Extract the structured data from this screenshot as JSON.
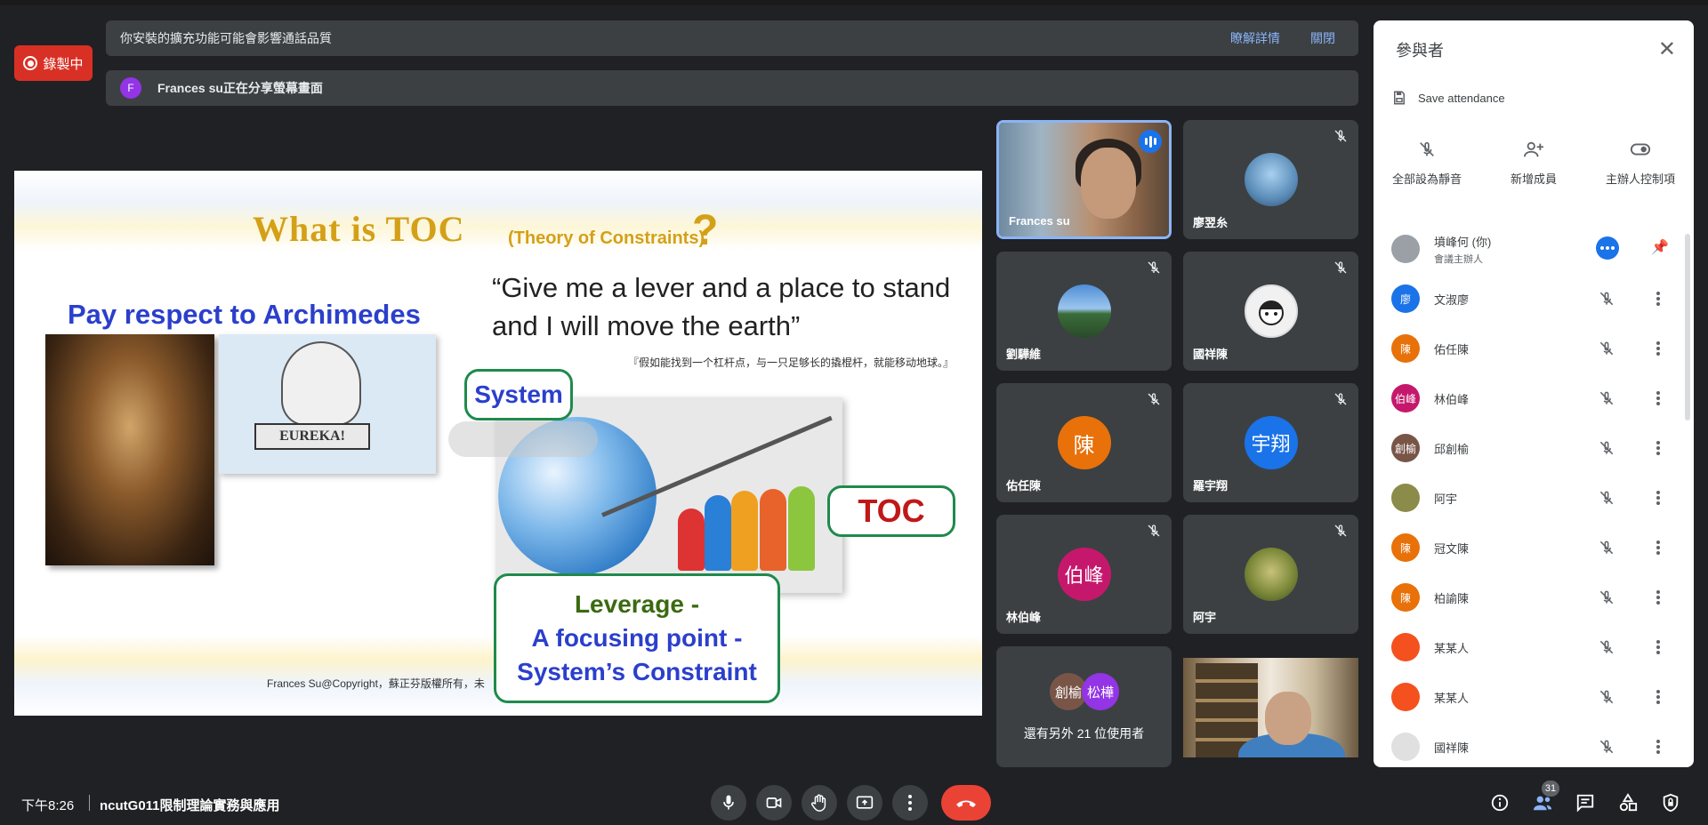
{
  "recording": {
    "label": "錄製中"
  },
  "banners": {
    "extension_warning": "你安裝的擴充功能可能會影響通話品質",
    "learn_more": "瞭解詳情",
    "close": "關閉",
    "sharing_avatar": "F",
    "sharing_text": "Frances su正在分享螢幕畫面"
  },
  "slide": {
    "title": "What is TOC",
    "subtitle": "(Theory of Constraints)",
    "question_mark": "?",
    "respect": "Pay respect to  Archimedes",
    "quote": "“Give me a lever and a place to stand and I will move the earth”",
    "chinese_quote": "『假如能找到一个杠杆点，与一只足够长的撬棍杆，就能移动地球。』",
    "eureka": "EUREKA!",
    "system_bubble": "System",
    "toc_bubble": "TOC",
    "leverage_line1": "Leverage -",
    "leverage_line2": "A focusing point -",
    "leverage_line3": "System’s Constraint",
    "copyright": "Frances Su@Copyright，蘇正芬版權所有，未"
  },
  "tiles": [
    {
      "name": "Frances su",
      "speaking": true
    },
    {
      "name": "廖翌糸",
      "muted": true
    },
    {
      "name": "劉驊維",
      "muted": true
    },
    {
      "name": "國祥陳",
      "muted": true
    },
    {
      "name": "佑任陳",
      "avatar": "陳",
      "color": "#e8710a",
      "muted": true
    },
    {
      "name": "羅宇翔",
      "avatar": "宇翔",
      "color": "#1a73e8",
      "muted": true
    },
    {
      "name": "林伯峰",
      "avatar": "伯峰",
      "color": "#c5186c",
      "muted": true
    },
    {
      "name": "阿宇",
      "muted": true
    }
  ],
  "more_tile": {
    "avatar1": "創榆",
    "avatar2": "松樺",
    "text": "還有另外 21 位使用者"
  },
  "panel": {
    "title": "參與者",
    "save_attendance": "Save attendance",
    "actions": [
      "全部設為靜音",
      "新增成員",
      "主辦人控制項"
    ],
    "participants": [
      {
        "name": "墳峰何 (你)",
        "role": "會議主辦人",
        "avatar": "",
        "color": "#9aa0a6"
      },
      {
        "name": "文淑廖",
        "avatar": "廖",
        "color": "#1a73e8"
      },
      {
        "name": "佑任陳",
        "avatar": "陳",
        "color": "#e8710a"
      },
      {
        "name": "林伯峰",
        "avatar": "伯峰",
        "color": "#c5186c"
      },
      {
        "name": "邱創榆",
        "avatar": "創榆",
        "color": "#795548"
      },
      {
        "name": "阿宇",
        "avatar": "",
        "color": "#8b8b4a"
      },
      {
        "name": "冠文陳",
        "avatar": "陳",
        "color": "#e8710a"
      },
      {
        "name": "柏諭陳",
        "avatar": "陳",
        "color": "#e8710a"
      },
      {
        "name": "某某人",
        "avatar": "",
        "color": "#f4511e"
      },
      {
        "name": "某某人",
        "avatar": "",
        "color": "#f4511e"
      },
      {
        "name": "國祥陳",
        "avatar": "",
        "color": "#e0e0e0"
      }
    ]
  },
  "bottom": {
    "time": "下午8:26",
    "meeting": "ncutG011限制理論實務與應用",
    "participant_count": "31"
  },
  "colors": {
    "accent": "#1a73e8",
    "end_call": "#ea4335",
    "recording": "#d93025"
  },
  "icons": [
    "mic-icon",
    "camera-icon",
    "raise-hand-icon",
    "present-icon",
    "more-vert-icon",
    "end-call-icon",
    "info-icon",
    "people-icon",
    "chat-icon",
    "activities-icon",
    "host-controls-icon"
  ]
}
